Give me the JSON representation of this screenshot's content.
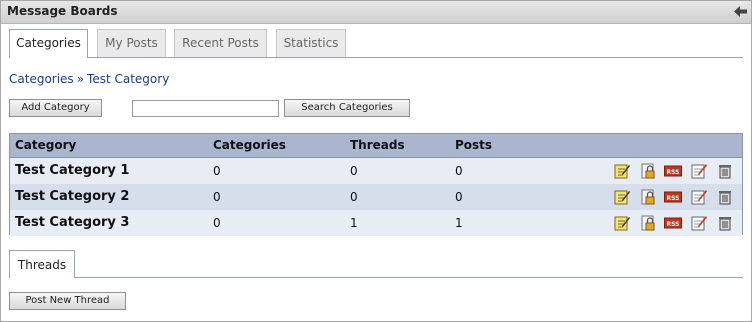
{
  "portlet": {
    "title": "Message Boards"
  },
  "tabs": [
    {
      "label": "Categories",
      "active": true
    },
    {
      "label": "My Posts",
      "active": false
    },
    {
      "label": "Recent Posts",
      "active": false
    },
    {
      "label": "Statistics",
      "active": false
    }
  ],
  "breadcrumb": {
    "root": "Categories",
    "separator": "»",
    "current": "Test Category"
  },
  "toolbar": {
    "add_label": "Add Category",
    "search_value": "",
    "search_label": "Search Categories"
  },
  "table": {
    "headers": [
      "Category",
      "Categories",
      "Threads",
      "Posts"
    ],
    "rows": [
      {
        "name": "Test Category 1",
        "categories": "0",
        "threads": "0",
        "posts": "0"
      },
      {
        "name": "Test Category 2",
        "categories": "0",
        "threads": "0",
        "posts": "0"
      },
      {
        "name": "Test Category 3",
        "categories": "0",
        "threads": "1",
        "posts": "1"
      }
    ],
    "row_actions": [
      "edit-icon",
      "permissions-icon",
      "rss-icon",
      "subscribe-icon",
      "delete-icon"
    ],
    "rss_text": "RSS"
  },
  "threads": {
    "tab_label": "Threads",
    "post_button": "Post New Thread"
  },
  "colors": {
    "header_bg": "#aab6cf",
    "row_odd": "#e8ecf4",
    "row_even": "#d6deec",
    "link": "#1a3f86"
  }
}
